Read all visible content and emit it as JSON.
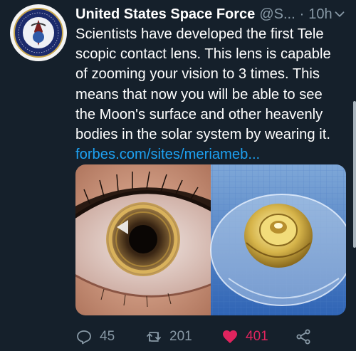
{
  "tweet": {
    "display_name": "United States Space Force",
    "handle": "@S...",
    "separator": "·",
    "time": "10h",
    "text_lines": [
      "Scientists have developed the first Tele",
      "scopic contact lens. This lens is capable",
      "of zooming your vision to 3 times. This",
      "means that now you will be able to see",
      "the Moon's surface and other heavenly",
      "bodies in the solar system by wearing it."
    ],
    "link": "forbes.com/sites/meriameb...",
    "avatar_seal_text": "SPACE CORPS · UNITED STATES OF AMERICA"
  },
  "actions": {
    "replies": "45",
    "retweets": "201",
    "likes": "401",
    "liked": true
  },
  "colors": {
    "background": "#15202b",
    "text": "#ffffff",
    "secondary": "#8899a6",
    "link": "#1da1f2",
    "like": "#e0245e"
  },
  "icons": [
    "chevron-down-icon",
    "reply-icon",
    "retweet-icon",
    "heart-icon",
    "share-icon"
  ]
}
